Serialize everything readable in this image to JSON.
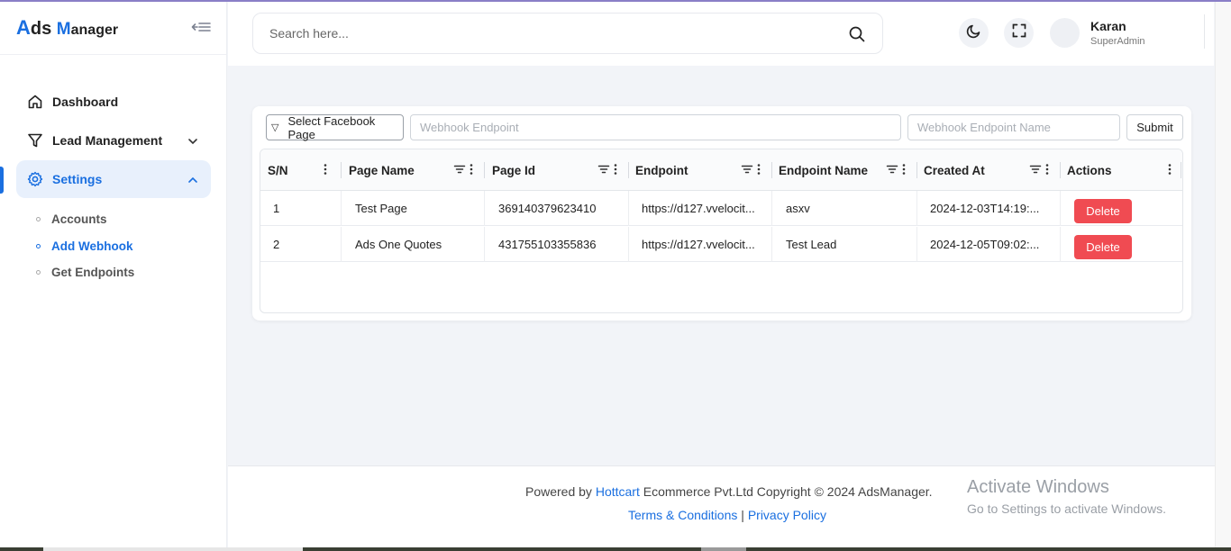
{
  "brand": {
    "first_letter": "A",
    "first_rest": "ds",
    "second_letter": "M",
    "second_rest": "anager"
  },
  "sidebar": {
    "items": [
      {
        "label": "Dashboard",
        "icon": "home-icon"
      },
      {
        "label": "Lead Management",
        "icon": "filter-icon"
      },
      {
        "label": "Settings",
        "icon": "gear-icon",
        "active": true
      }
    ],
    "sub_items": [
      {
        "label": "Accounts"
      },
      {
        "label": "Add Webhook",
        "current": true
      },
      {
        "label": "Get Endpoints"
      }
    ]
  },
  "header": {
    "search_placeholder": "Search here...",
    "user_name": "Karan",
    "user_role": "SuperAdmin"
  },
  "form": {
    "select_label": "Select Facebook Page",
    "endpoint_placeholder": "Webhook Endpoint",
    "endpoint_name_placeholder": "Webhook Endpoint Name",
    "submit_label": "Submit"
  },
  "table": {
    "columns": [
      "S/N",
      "Page Name",
      "Page Id",
      "Endpoint",
      "Endpoint Name",
      "Created At",
      "Actions"
    ],
    "rows": [
      {
        "sn": "1",
        "page_name": "Test Page",
        "page_id": "369140379623410",
        "endpoint": "https://d127.vvelocit...",
        "endpoint_name": "asxv",
        "created_at": "2024-12-03T14:19:...",
        "action": "Delete"
      },
      {
        "sn": "2",
        "page_name": "Ads One Quotes",
        "page_id": "431755103355836",
        "endpoint": "https://d127.vvelocit...",
        "endpoint_name": "Test Lead",
        "created_at": "2024-12-05T09:02:...",
        "action": "Delete"
      }
    ]
  },
  "footer": {
    "powered_prefix": "Powered by ",
    "powered_link": "Hottcart",
    "powered_suffix": " Ecommerce Pvt.Ltd Copyright © 2024 AdsManager.",
    "terms": "Terms & Conditions",
    "separator": "|",
    "privacy": "Privacy Policy"
  },
  "watermark": {
    "title": "Activate Windows",
    "subtitle": "Go to Settings to activate Windows."
  },
  "colors": {
    "accent": "#1a6fe0",
    "danger": "#f04b52"
  }
}
